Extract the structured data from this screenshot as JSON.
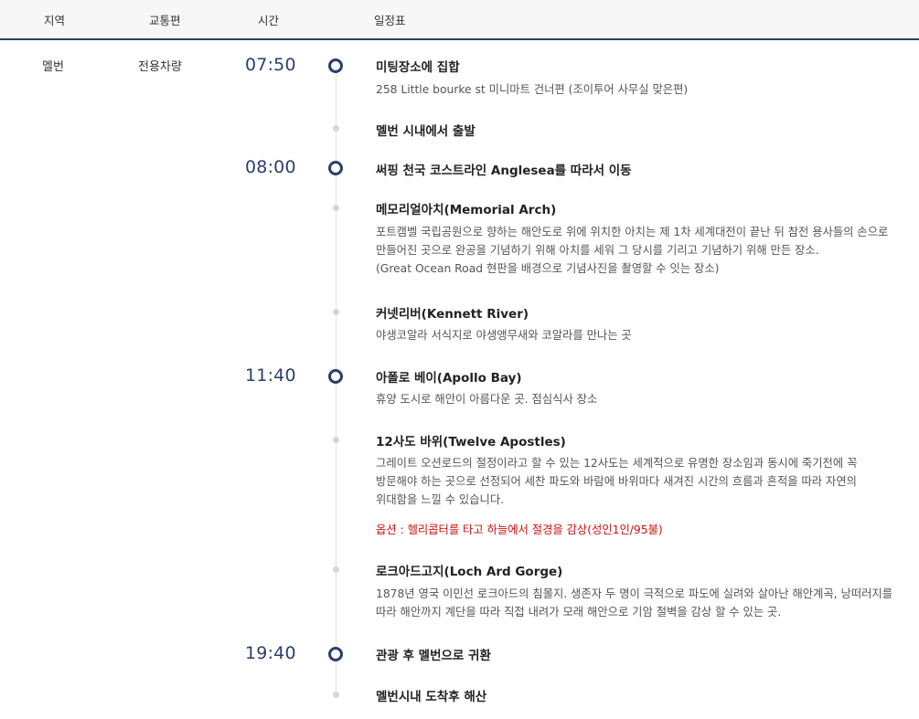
{
  "header": {
    "col_region": "지역",
    "col_transport": "교통편",
    "col_time": "시간",
    "col_schedule": "일정표"
  },
  "row": {
    "region": "멜번",
    "transport": "전용차량"
  },
  "items": [
    {
      "time": "07:50",
      "title": "미팅장소에 집합",
      "desc": [
        "258 Little bourke st 미니마트 건너편 (조이투어 사무실 맞은편)"
      ]
    },
    {
      "time": "",
      "title": "멜번 시내에서 출발",
      "desc": []
    },
    {
      "time": "08:00",
      "title": "써핑 천국 코스트라인 Anglesea를 따라서 이동",
      "desc": []
    },
    {
      "time": "",
      "title": "메모리얼아치(Memorial Arch)",
      "desc": [
        "포트캠벨 국립공원으로 향하는 해안도로 위에 위치한 아치는 제 1차 세계대전이 끝난 뒤 참전 용사들의 손으로",
        "만들어진 곳으로 완공을 기념하기 위해 아치를 세워 그 당시를 기리고 기념하기 위해 만든 장소.",
        "(Great Ocean Road 현판을 배경으로 기념사진을 촬영할 수 잇는 장소)"
      ]
    },
    {
      "time": "",
      "title": "커넷리버(Kennett River)",
      "desc": [
        "야생코알라 서식지로 야생앵무새와 코알라를 만나는 곳"
      ]
    },
    {
      "time": "11:40",
      "title": "아폴로 베이(Apollo Bay)",
      "desc": [
        "휴양 도시로 해안이 아름다운 곳. 점심식사 장소"
      ]
    },
    {
      "time": "",
      "title": "12사도 바위(Twelve Apostles)",
      "desc": [
        "그레이트 오션로드의 절정이라고 할 수 있는 12사도는 세계적으로 유명한 장소임과 동시에 죽기전에 꼭",
        "방문해야 하는 곳으로 선정되어 세찬 파도와 바람에 바위마다 새겨진 시간의 흐름과 흔적을 따라 자연의",
        "위대함을 느낄 수 있습니다."
      ],
      "option": "옵션 : 헬리콥터를 타고 하늘에서 절경을 감상(성인1인/95불)"
    },
    {
      "time": "",
      "title": "로크아드고지(Loch Ard Gorge)",
      "desc": [
        "1878년 영국 이민선 로크아드의 침몰지. 생존자 두 명이 극적으로 파도에 실려와 살아난 해안계곡, 낭떠러지를",
        "따라 해안까지 계단을 따라 직접 내려가 모래 해안으로 기암 절벽을 감상 할 수 있는 곳."
      ]
    },
    {
      "time": "19:40",
      "title": "관광 후 멜번으로 귀환",
      "desc": []
    },
    {
      "time": "",
      "title": "멜번시내 도착후 해산",
      "desc": []
    }
  ],
  "colors": {
    "accent": "#2b3f6b",
    "option": "#cc1111"
  }
}
